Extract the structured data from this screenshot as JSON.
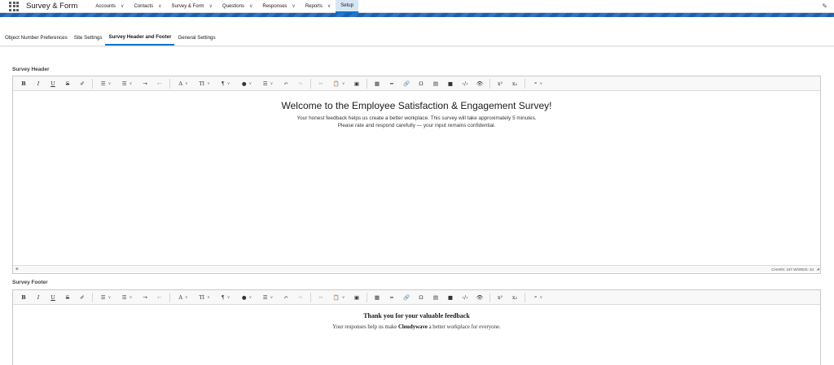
{
  "app": {
    "name": "Survey & Form",
    "nav": [
      {
        "label": "Accounts"
      },
      {
        "label": "Contacts"
      },
      {
        "label": "Survey & Form"
      },
      {
        "label": "Questions"
      },
      {
        "label": "Responses"
      },
      {
        "label": "Reports"
      },
      {
        "label": "Setup"
      }
    ]
  },
  "tabs": [
    {
      "label": "Object Number Preferences"
    },
    {
      "label": "Site Settings"
    },
    {
      "label": "Survey Header and Footer"
    },
    {
      "label": "General Settings"
    }
  ],
  "active_tab": "Survey Header and Footer",
  "header_section": {
    "label": "Survey Header",
    "title": "Welcome to the Employee Satisfaction & Engagement Survey!",
    "line1": "Your honest feedback helps us create a better workplace. This survey will take approximately 5 minutes.",
    "line2": "Please rate and respond carefully — your input remains confidential.",
    "path": "⊕",
    "count": "CHARS: 197  WORDS: 34"
  },
  "footer_section": {
    "label": "Survey Footer",
    "title": "Thank you for your valuable feedback",
    "text_before": "Your responses help us make ",
    "text_bold": "Cloudywave",
    "text_after": " a better workplace for everyone."
  },
  "toolbar": {
    "bold": "B",
    "italic": "I",
    "underline": "U",
    "strike": "S",
    "eraser": "✐",
    "bullets": "☰",
    "numbers": "☰",
    "indent": "⇥",
    "outdent": "⇤",
    "font": "A",
    "size": "TI",
    "paragraph": "¶",
    "color": "●",
    "align": "☰",
    "undo": "↶",
    "redo": "↷",
    "cut": "✂",
    "paste": "📋",
    "image_frame": "▣",
    "table": "▦",
    "hr": "━",
    "link": "🔗",
    "omega": "Ω",
    "doc": "▤",
    "video": "■",
    "code": "‹/›",
    "preview": "👁",
    "sup": "x²",
    "sub": "x₂",
    "find": "⌕",
    "chev": "∨"
  }
}
